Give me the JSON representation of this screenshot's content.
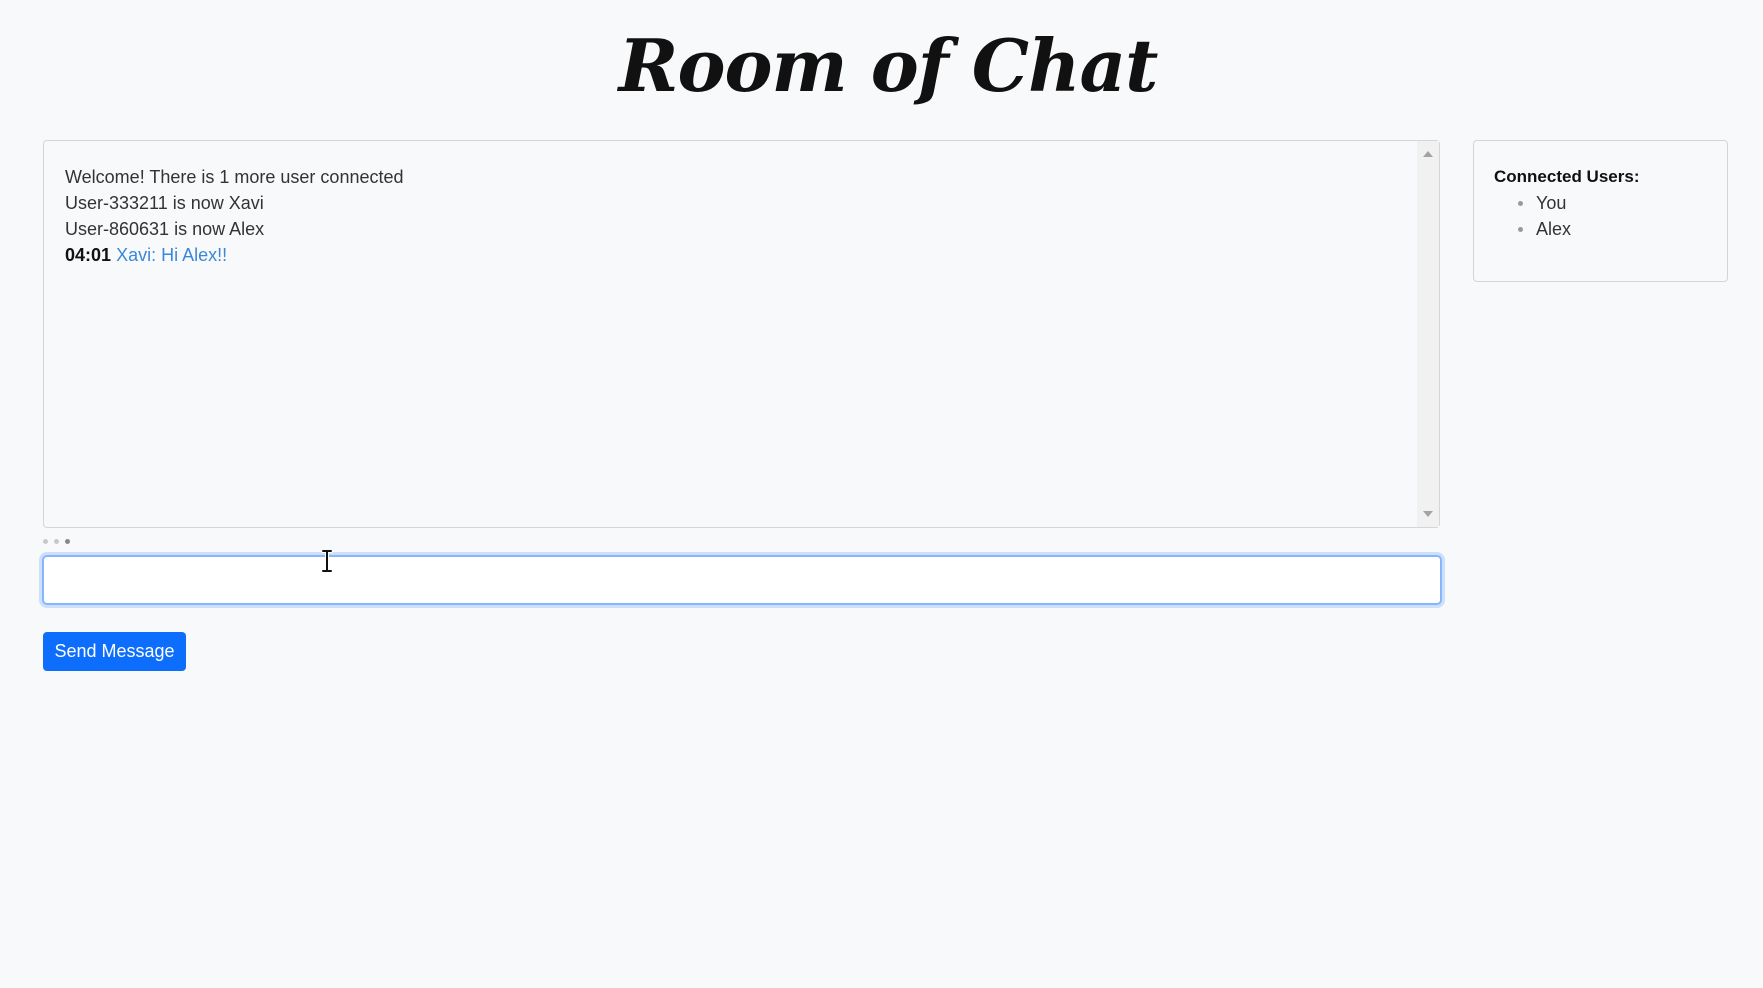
{
  "header": {
    "title": "Room of Chat"
  },
  "chat": {
    "messages": [
      "Welcome! There is 1 more user connected",
      "User-333211 is now Xavi",
      "User-860631 is now Alex"
    ],
    "latest": {
      "time": "04:01",
      "text": "Xavi: Hi Alex!!"
    }
  },
  "composer": {
    "value": "",
    "send_label": "Send Message"
  },
  "users": {
    "heading": "Connected Users:",
    "list": [
      "You",
      "Alex"
    ]
  },
  "colors": {
    "background": "#f8f9fa",
    "accent": "#0d6efd",
    "user_message": "#3b88d8",
    "input_focus_border": "#86b7fe"
  },
  "icons": {
    "cursor": "text-cursor-icon",
    "scroll_up": "scroll-up-arrow-icon",
    "scroll_down": "scroll-down-arrow-icon"
  }
}
